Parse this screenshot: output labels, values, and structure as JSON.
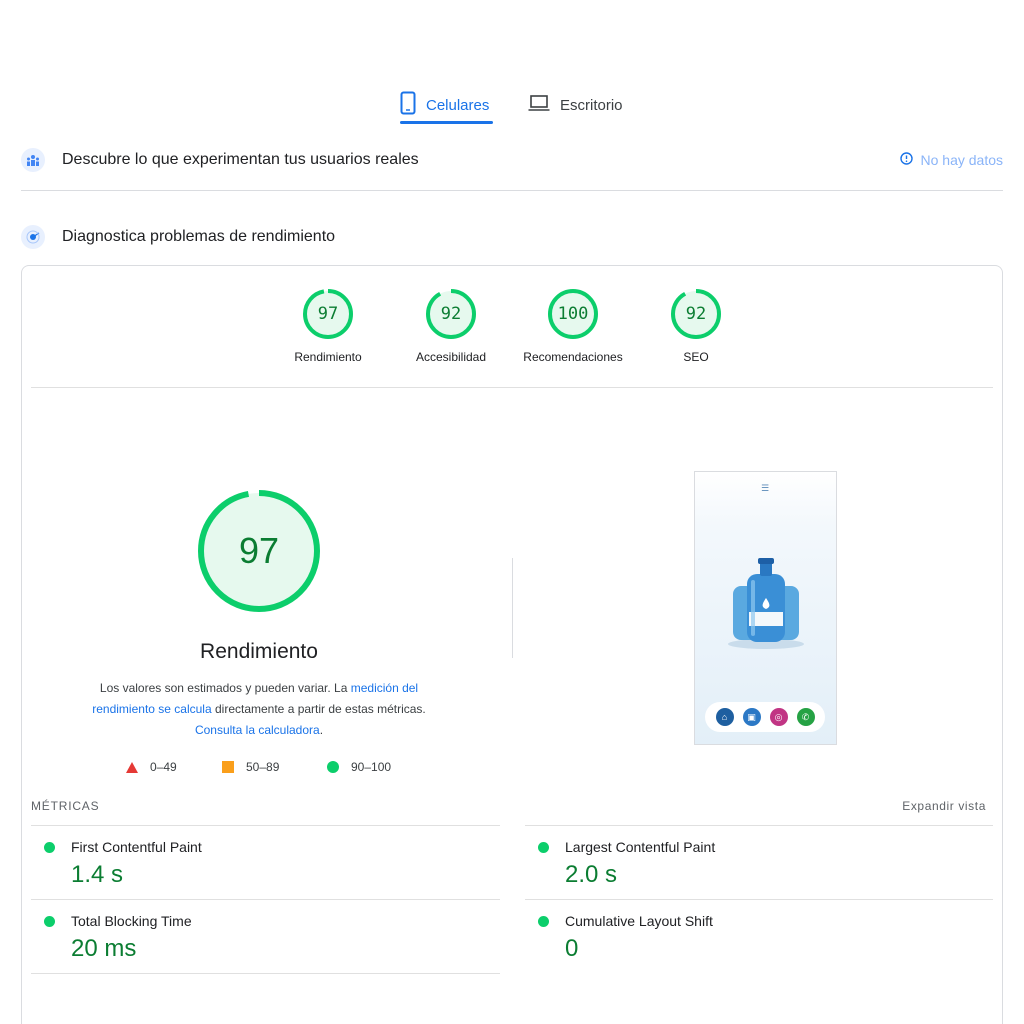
{
  "tabs": {
    "mobile_label": "Celulares",
    "desktop_label": "Escritorio"
  },
  "field_data": {
    "title": "Descubre lo que experimentan tus usuarios reales",
    "status": "No hay datos"
  },
  "lab_data": {
    "title": "Diagnostica problemas de rendimiento"
  },
  "scores": [
    {
      "label": "Rendimiento",
      "value": "97",
      "fraction": 0.97
    },
    {
      "label": "Accesibilidad",
      "value": "92",
      "fraction": 0.92
    },
    {
      "label": "Recomendaciones",
      "value": "100",
      "fraction": 1.0
    },
    {
      "label": "SEO",
      "value": "92",
      "fraction": 0.92
    }
  ],
  "main_score": {
    "value": "97",
    "fraction": 0.97,
    "title": "Rendimiento",
    "desc_1": "Los valores son estimados y pueden variar. La ",
    "desc_link_1": "medición del rendimiento se calcula",
    "desc_2": " directamente a partir de estas métricas. ",
    "desc_link_2": "Consulta la calculadora",
    "desc_3": "."
  },
  "legend": {
    "fail": "0–49",
    "average": "50–89",
    "pass": "90–100"
  },
  "metrics": {
    "title": "MÉTRICAS",
    "expand_label": "Expandir vista",
    "items": [
      {
        "label": "First Contentful Paint",
        "value": "1.4 s"
      },
      {
        "label": "Largest Contentful Paint",
        "value": "2.0 s"
      },
      {
        "label": "Total Blocking Time",
        "value": "20 ms"
      },
      {
        "label": "Cumulative Layout Shift",
        "value": "0"
      }
    ]
  },
  "colors": {
    "accent": "#1a73e8",
    "pass": "#0cce6b",
    "pass_text": "#0b7d32",
    "average": "#fa9f1b",
    "fail": "#e53935"
  }
}
